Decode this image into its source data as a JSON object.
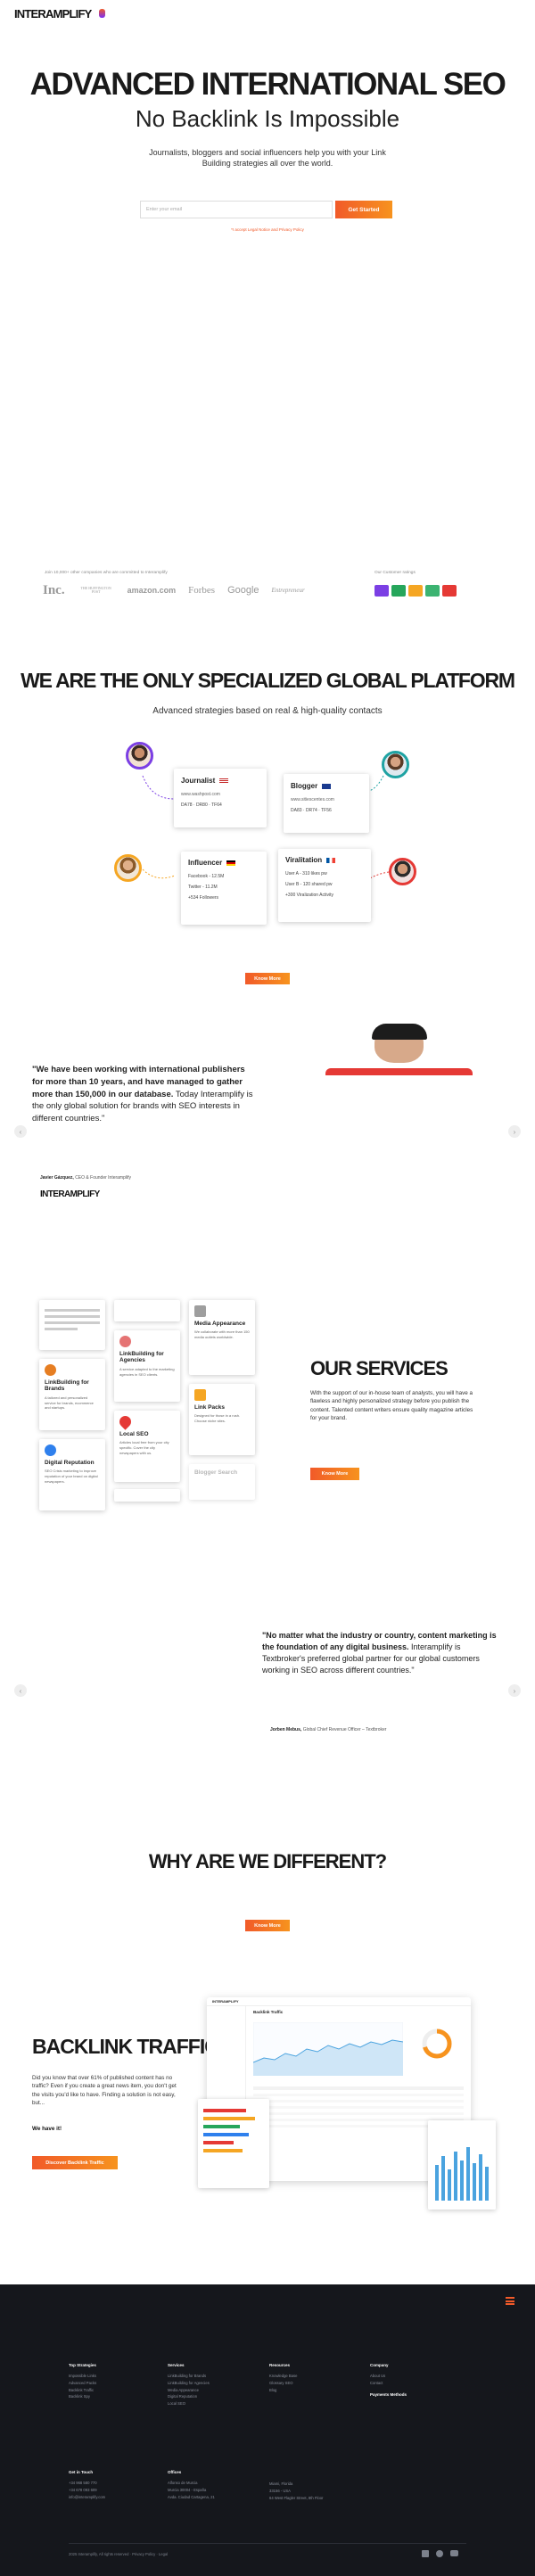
{
  "header": {
    "logo": "INTERAMPLIFY"
  },
  "hero": {
    "title": "ADVANCED INTERNATIONAL SEO",
    "subtitle": "No Backlink Is Impossible",
    "description": "Journalists, bloggers and social influencers help you with your Link Building strategies all over the world.",
    "email_placeholder": "Enter your email",
    "cta": "Get Started",
    "legal": "*I accept Legal Notice and Privacy Policy"
  },
  "logos": {
    "caption": "Join 10,000+ other companies who are committed to Interamplify",
    "brands": [
      "Inc.",
      "THE HUFFINGTON POST",
      "amazon.com",
      "Forbes",
      "Google",
      "Entrepreneur"
    ],
    "ratings_caption": "Our Customer ratings"
  },
  "platform": {
    "title": "WE ARE THE ONLY SPECIALIZED GLOBAL PLATFORM",
    "subtitle": "Advanced strategies based on real & high-quality contacts",
    "cards": [
      {
        "name": "Journalist",
        "lines": [
          "www.washpost.com",
          "DA78 · DR80 · TF64"
        ]
      },
      {
        "name": "Blogger",
        "lines": [
          "www.sitiescentes.com",
          "DA83 · DR74 · TF56"
        ]
      },
      {
        "name": "Influencer",
        "lines": [
          "Facebook - 12.5M",
          "Twitter - 11.2M",
          "+534 Followers"
        ]
      },
      {
        "name": "Viralitation",
        "lines": [
          "User A - 310 likes pw",
          "User B - 120 shared pw",
          "+300 Viralization Activity"
        ]
      }
    ],
    "cta": "Know More"
  },
  "testimonial1": {
    "quote_bold": "\"We have been working with international publishers for more than 10 years, and have managed to gather more than 150,000 in our database.",
    "quote_rest": "Today Interamplify is the only global solution for brands with SEO interests in different countries.\"",
    "author": "Javier Gázquez,",
    "role": "CEO & Founder Interamplify",
    "logo": "INTERAMPLIFY"
  },
  "services": {
    "title": "OUR SERVICES",
    "description": "With the support of our in-house team of analysts, you will have a flawless and highly personalized strategy before you publish the content. Talented content writers ensure quality magazine articles for your brand.",
    "cta": "Know More",
    "items": [
      {
        "name": "LinkBuilding for Brands",
        "desc": "A tailored and personalized service for brands, ecommerce and startups."
      },
      {
        "name": "Digital Reputation",
        "desc": "SEO Crisis marketing to improve reputation of your brand on digital newspapers."
      },
      {
        "name": "LinkBuilding for Agencies",
        "desc": "A service adapted to the marketing agencies in SEO clients."
      },
      {
        "name": "Local SEO",
        "desc": "Articles local free from your city specific. Cover the city newspapers with us."
      },
      {
        "name": "Media Appearance",
        "desc": "We collaborate with more than 150 media outlets worldwide."
      },
      {
        "name": "Link Packs",
        "desc": "Designed for those in a rush. Choose niche sites."
      },
      {
        "name": "Blogger Search",
        "desc": ""
      }
    ]
  },
  "testimonial2": {
    "quote_bold": "\"No matter what the industry or country, content marketing is the foundation of any digital business.",
    "quote_rest": "Interamplify is Textbroker's preferred global partner for our global customers working in SEO across different countries.\"",
    "author": "Jorben Mebus,",
    "role": "Global Chief Revenue Officer – Textbroker"
  },
  "different": {
    "title": "WHY ARE WE DIFFERENT?",
    "cta": "Know More"
  },
  "backlink": {
    "title": "BACKLINK TRAFFIC",
    "description": "Did you know that over 61% of published content has no traffic? Even if you create a great news item, you don't get the visits you'd like to have. Finding a solution is not easy, but...",
    "emphasis": "We have it!",
    "cta": "Discover Backlink Traffic",
    "dash_title": "Backlink Traffic"
  },
  "footer": {
    "columns": [
      {
        "title": "Top Strategies",
        "items": [
          "Impossible Links",
          "Advanced Packs",
          "Backlink Traffic",
          "Backlink Spy"
        ]
      },
      {
        "title": "Services",
        "items": [
          "LinkBuilding for Brands",
          "LinkBuilding for Agencies",
          "Media Appearance",
          "Digital Reputation",
          "Local SEO"
        ]
      },
      {
        "title": "Resources",
        "items": [
          "Knowledge Base",
          "Glossary SEO",
          "Blog"
        ]
      },
      {
        "title": "Company",
        "items": [
          "About Us",
          "Contact"
        ],
        "extra": "Payments Methods"
      }
    ],
    "contact": {
      "title": "Get in Touch",
      "items": [
        "+34 968 580 770",
        "+34 678 093 609",
        "info@interamplify.com"
      ]
    },
    "offices": {
      "title": "Offices",
      "col1": [
        "Alfonso de Murcia",
        "Murcia 30004 - España",
        "Avda. Ciudad Cartagena, 21"
      ],
      "col2": [
        "Miami, Florida",
        "33156 - USA",
        "64 West Flagler Street, 8th Floor"
      ]
    },
    "copyright": "2025 Interamplify, All rights reserved · Privacy Policy · Legal"
  },
  "colors": {
    "accent": "#f15a29",
    "accent2": "#f7931e",
    "footer_bg": "#15171c"
  }
}
